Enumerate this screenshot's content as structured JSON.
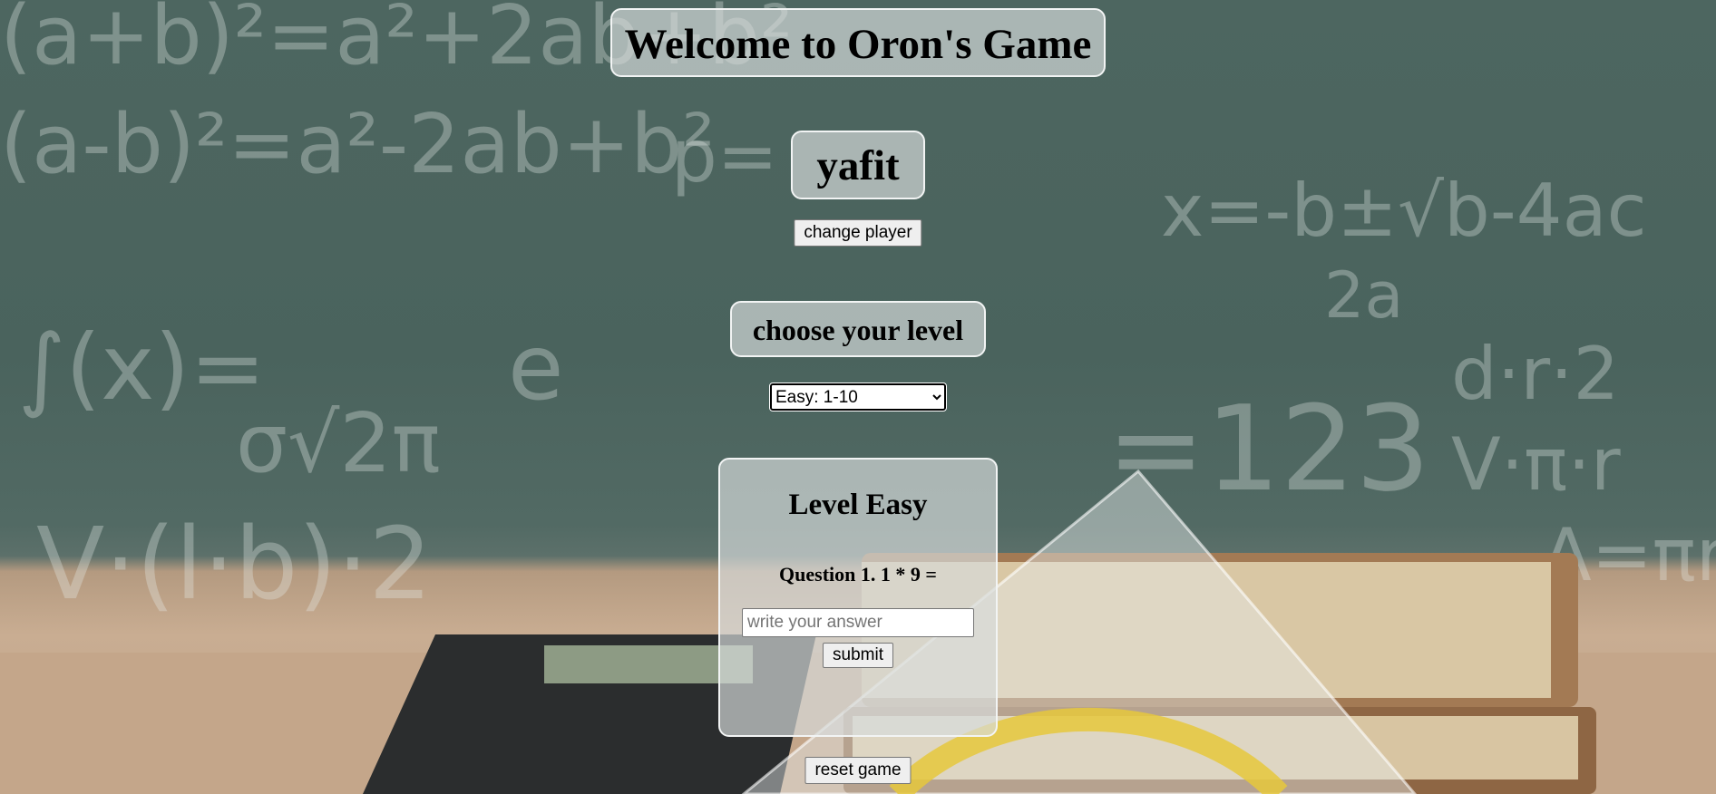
{
  "header": {
    "title": "Welcome to Oron's Game"
  },
  "player": {
    "name": "yafit",
    "change_label": "change player"
  },
  "level_picker": {
    "heading": "choose your level",
    "selected": "Easy: 1-10",
    "options": [
      "Easy: 1-10"
    ]
  },
  "game": {
    "level_title": "Level Easy",
    "question": "Question 1. 1 * 9 =",
    "answer_placeholder": "write your answer",
    "submit_label": "submit"
  },
  "footer": {
    "reset_label": "reset game"
  }
}
